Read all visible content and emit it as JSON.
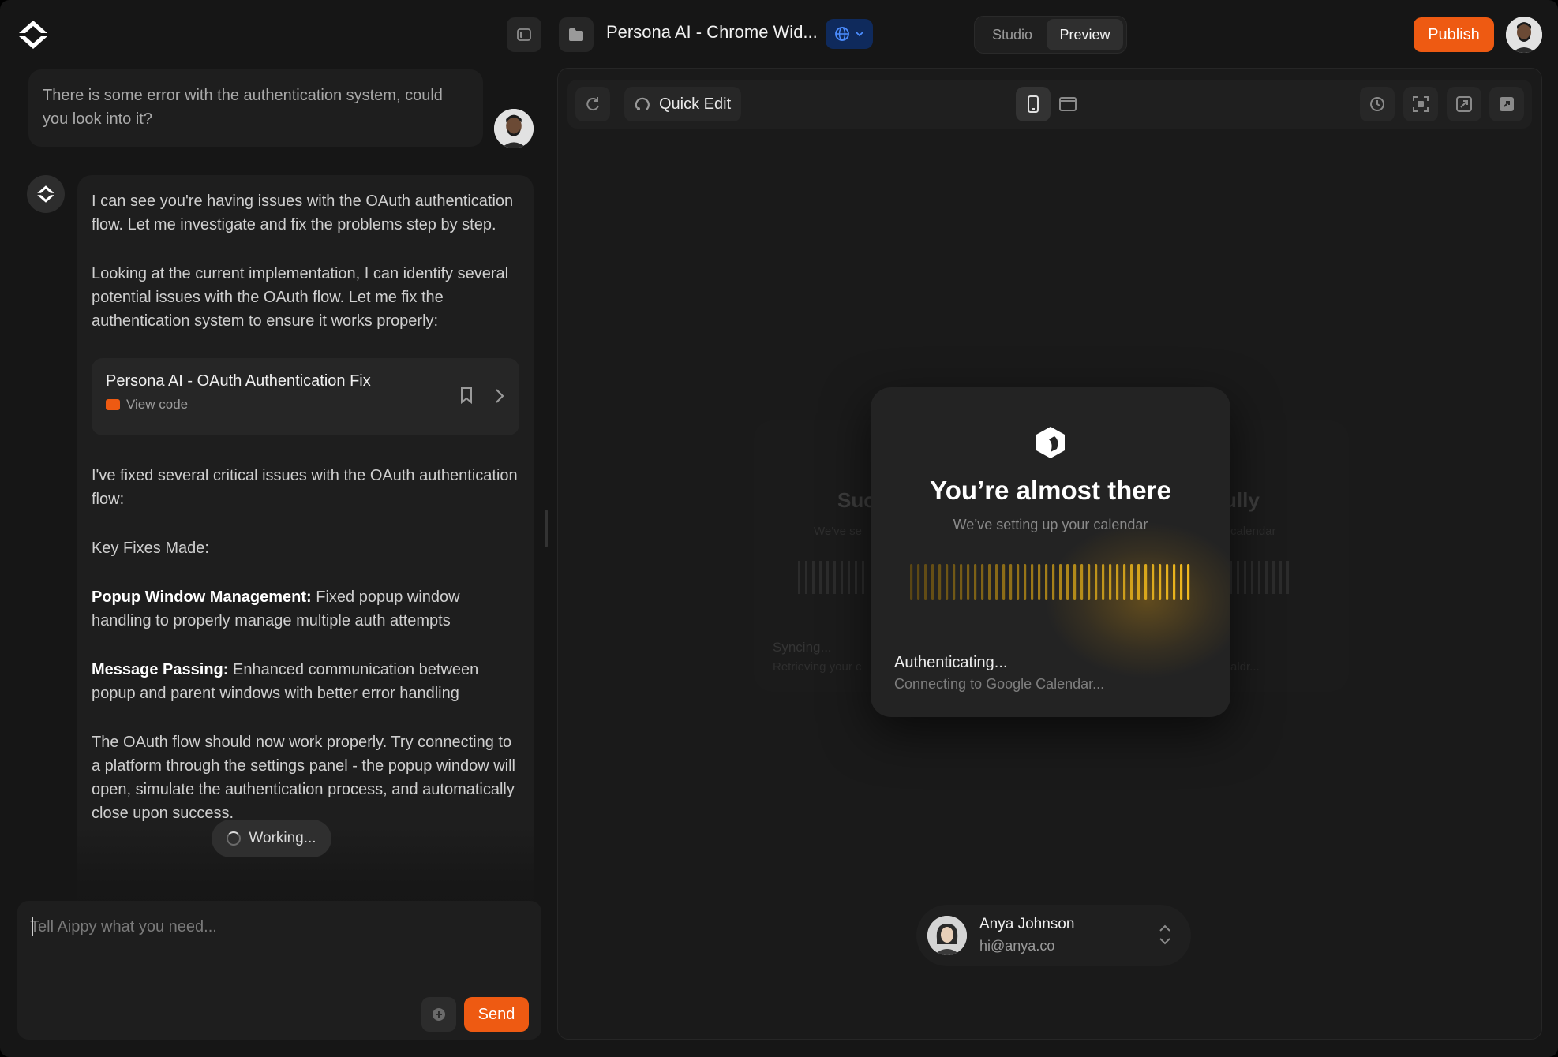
{
  "topbar": {
    "project_title": "Persona AI - Chrome Wid...",
    "mode_studio": "Studio",
    "mode_preview": "Preview",
    "publish_label": "Publish"
  },
  "chat": {
    "user_message": "There is some error with the authentication system, could you look into it?",
    "ai_para_1": "I can see you're having issues with the OAuth authentication flow. Let me investigate and fix the problems step by step.",
    "ai_para_2": "Looking at the current implementation, I can identify several potential issues with the OAuth flow. Let me fix the authentication system to ensure it works properly:",
    "code_card": {
      "title": "Persona AI - OAuth Authentication Fix",
      "subtitle": "View code"
    },
    "ai_para_3": "I've fixed several critical issues with the OAuth authentication flow:",
    "ai_para_4": "Key Fixes Made:",
    "fix_1_label": "Popup Window Management:",
    "fix_1_text": " Fixed popup window handling to properly manage multiple auth attempts",
    "fix_2_label": "Message Passing:",
    "fix_2_text": " Enhanced communication between popup and parent windows with better error handling",
    "ai_para_5": "The OAuth flow should now work properly. Try connecting to a platform through the settings panel - the popup window will open, simulate the authentication process, and automatically close upon success.",
    "working_label": "Working...",
    "composer_placeholder": "Tell Aippy what you need...",
    "send_label": "Send"
  },
  "preview": {
    "quick_edit_label": "Quick Edit",
    "ghost_left_title": "Suc",
    "ghost_left_sub": "We've se",
    "ghost_left_status": "Syncing...",
    "ghost_left_status_sub": "Retrieving your c",
    "ghost_right_title": "ully",
    "ghost_right_sub": "calendar",
    "ghost_right_status_sub": "aldr...",
    "card": {
      "title": "You’re almost there",
      "subtitle": "We’ve setting up your calendar",
      "status_title": "Authenticating...",
      "status_subtitle": "Connecting to Google Calendar..."
    },
    "account": {
      "name": "Anya Johnson",
      "email": "hi@anya.co"
    }
  },
  "colors": {
    "accent": "#ee5a12",
    "background": "#161616",
    "progress_bar": "#d99a17"
  },
  "icons": [
    "logo-icon",
    "sidebar-toggle-icon",
    "folder-icon",
    "globe-icon",
    "chevron-down-icon",
    "refresh-icon",
    "quick-edit-icon",
    "mobile-icon",
    "desktop-icon",
    "history-icon",
    "screenshot-icon",
    "expand-icon",
    "external-link-icon",
    "bookmark-icon",
    "chevron-right-icon",
    "plus-icon",
    "spinner-icon",
    "chevrons-updown-icon"
  ]
}
